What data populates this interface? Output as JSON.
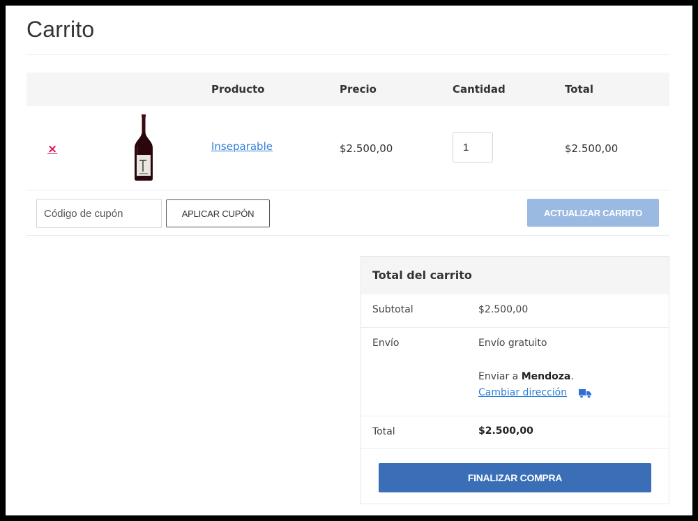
{
  "page": {
    "title": "Carrito"
  },
  "cart_table": {
    "headers": {
      "product": "Producto",
      "price": "Precio",
      "quantity": "Cantidad",
      "total": "Total"
    },
    "items": [
      {
        "remove_label": "×",
        "product_name": "Inseparable",
        "price": "$2.500,00",
        "quantity": "1",
        "total": "$2.500,00"
      }
    ]
  },
  "actions": {
    "coupon_placeholder": "Código de cupón",
    "apply_coupon_label": "APLICAR CUPÓN",
    "update_cart_label": "ACTUALIZAR CARRITO"
  },
  "totals": {
    "title": "Total del carrito",
    "subtotal_label": "Subtotal",
    "subtotal_value": "$2.500,00",
    "shipping_label": "Envío",
    "shipping_method": "Envío gratuito",
    "ship_to_prefix": "Enviar a ",
    "ship_to_location": "Mendoza",
    "ship_to_suffix": ".",
    "change_address_label": "Cambiar dirección",
    "total_label": "Total",
    "total_value": "$2.500,00",
    "checkout_label": "FINALIZAR COMPRA"
  },
  "colors": {
    "remove": "#e0115f",
    "link": "#2f7ed8",
    "update_button": "#9bbae2",
    "checkout_button": "#3a6eb6",
    "header_background": "#f5f5f5"
  },
  "icons": {
    "remove": "close-icon",
    "address": "truck-icon"
  }
}
